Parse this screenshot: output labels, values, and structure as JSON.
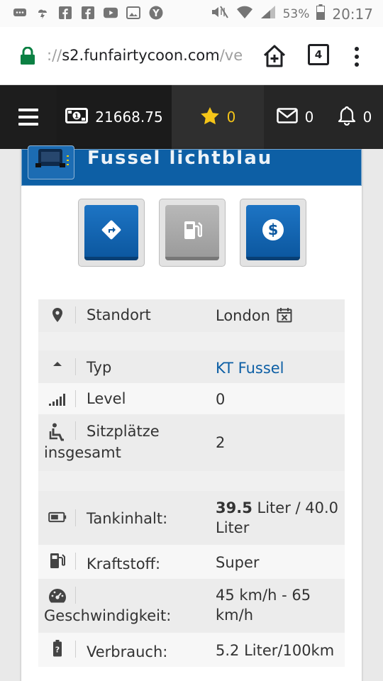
{
  "status_bar": {
    "battery": "53%",
    "time": "20:17",
    "icons": [
      "chat-icon",
      "weather-icon",
      "facebook-icon",
      "facebook-icon",
      "youtube-icon",
      "gallery-icon",
      "yahoo-icon",
      "mute-icon",
      "wifi-icon",
      "signal-icon",
      "battery-icon"
    ]
  },
  "browser": {
    "url_prefix": "://",
    "url_host": "s2.funfairtycoon.com",
    "url_path": "/ve",
    "tab_count": "4"
  },
  "game_nav": {
    "money": "21668.75",
    "stars": "0",
    "messages": "0",
    "notifications": "0"
  },
  "vehicle": {
    "title": "Fussel lichtblau"
  },
  "actions": [
    {
      "name": "route-icon"
    },
    {
      "name": "fuel-icon"
    },
    {
      "name": "dollar-icon"
    }
  ],
  "details": {
    "location_label": "Standort",
    "location_value": "London",
    "type_label": "Typ",
    "type_value": "KT Fussel",
    "level_label": "Level",
    "level_value": "0",
    "seats_label_1": "Sitzplätze",
    "seats_label_2": "insgesamt",
    "seats_value": "2",
    "tank_label": "Tankinhalt:",
    "tank_value_bold": "39.5",
    "tank_value_rest_1": " Liter / 40.0",
    "tank_value_rest_2": "Liter",
    "fuel_label": "Kraftstoff:",
    "fuel_value": "Super",
    "speed_label": "Geschwindigkeit:",
    "speed_value_1": "45 km/h - 65",
    "speed_value_2": "km/h",
    "consumption_label": "Verbrauch:",
    "consumption_value": "5.2 Liter/100km"
  }
}
